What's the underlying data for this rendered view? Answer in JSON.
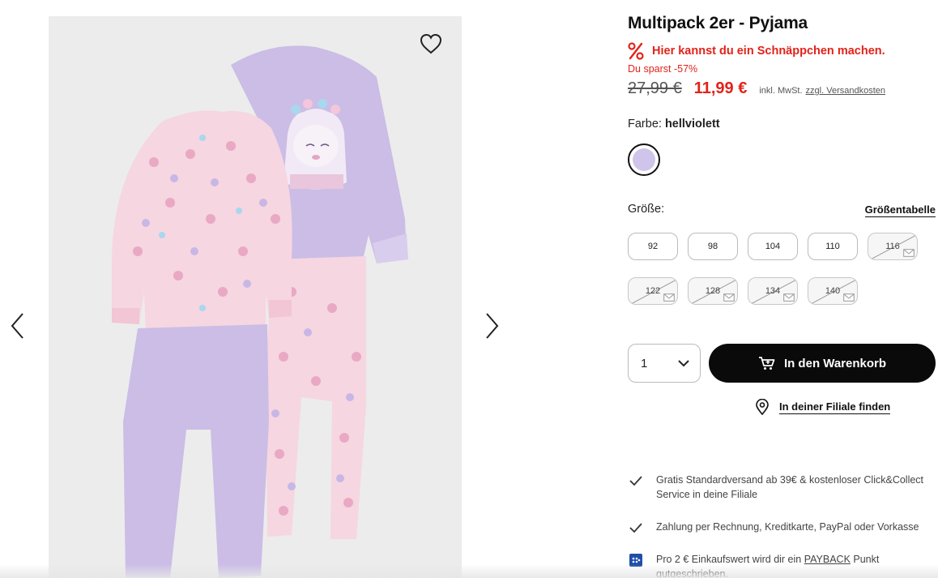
{
  "gallery": {
    "wishlist_icon": "heart-outline-icon",
    "prev_icon": "chevron-left-icon",
    "next_icon": "chevron-right-icon",
    "image_background": "#ececec"
  },
  "product": {
    "title": "Multipack 2er - Pyjama",
    "deal_text": "Hier kannst du ein Schnäppchen machen.",
    "savings_text": "Du sparst -57%",
    "old_price": "27,99 €",
    "new_price": "11,99 €",
    "tax_note": "inkl. MwSt.",
    "shipping_link": "zzgl. Versandkosten",
    "accent_color": "#e2231a"
  },
  "color": {
    "label": "Farbe:",
    "selected": "hellviolett",
    "swatch_color": "#cfc5ea"
  },
  "sizes": {
    "label": "Größe:",
    "chart_link": "Größentabelle",
    "options": [
      {
        "label": "92",
        "available": true
      },
      {
        "label": "98",
        "available": true
      },
      {
        "label": "104",
        "available": true
      },
      {
        "label": "110",
        "available": true
      },
      {
        "label": "116",
        "available": false
      },
      {
        "label": "122",
        "available": false
      },
      {
        "label": "128",
        "available": false
      },
      {
        "label": "134",
        "available": false
      },
      {
        "label": "140",
        "available": false
      }
    ]
  },
  "purchase": {
    "quantity": "1",
    "add_to_cart": "In den Warenkorb",
    "find_in_store": "In deiner Filiale finden"
  },
  "benefits": [
    {
      "icon": "check-icon",
      "text": "Gratis Standardversand ab 39€ & kostenloser Click&Collect Service in deine Filiale"
    },
    {
      "icon": "check-icon",
      "text": "Zahlung per Rechnung, Kreditkarte, PayPal oder Vorkasse"
    },
    {
      "icon": "payback-icon",
      "text_before": "Pro 2 € Einkaufswert wird dir ein ",
      "link": "PAYBACK",
      "text_after": " Punkt gutgeschrieben."
    }
  ]
}
